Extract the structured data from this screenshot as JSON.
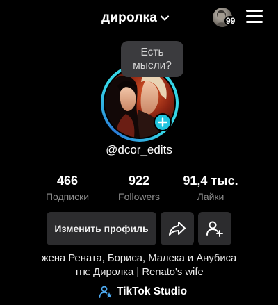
{
  "header": {
    "account_name": "диролка",
    "avatar_badge_count": "99",
    "icons": {
      "switch": "chevron-down-icon",
      "menu": "hamburger-menu-icon"
    }
  },
  "profile": {
    "thought_bubble": "Есть мысли?",
    "username": "@dcor_edits",
    "ring_color": "#36d6e7",
    "add_button_color": "#20c4df"
  },
  "stats": [
    {
      "value": "466",
      "label": "Подписки"
    },
    {
      "value": "922",
      "label": "Followers"
    },
    {
      "value": "91,4 тыс.",
      "label": "Лайки"
    }
  ],
  "actions": {
    "edit_profile": "Изменить профиль",
    "share_icon": "share-arrow-icon",
    "add_friend_icon": "add-friend-icon"
  },
  "bio": {
    "line1": "жена Рената, Бориса, Малека и Анубиса",
    "line2": "тгк: Диролка | Renato's wife"
  },
  "studio": {
    "label": "TikTok Studio",
    "icon": "person-star-icon",
    "icon_color": "#4da9f0"
  }
}
